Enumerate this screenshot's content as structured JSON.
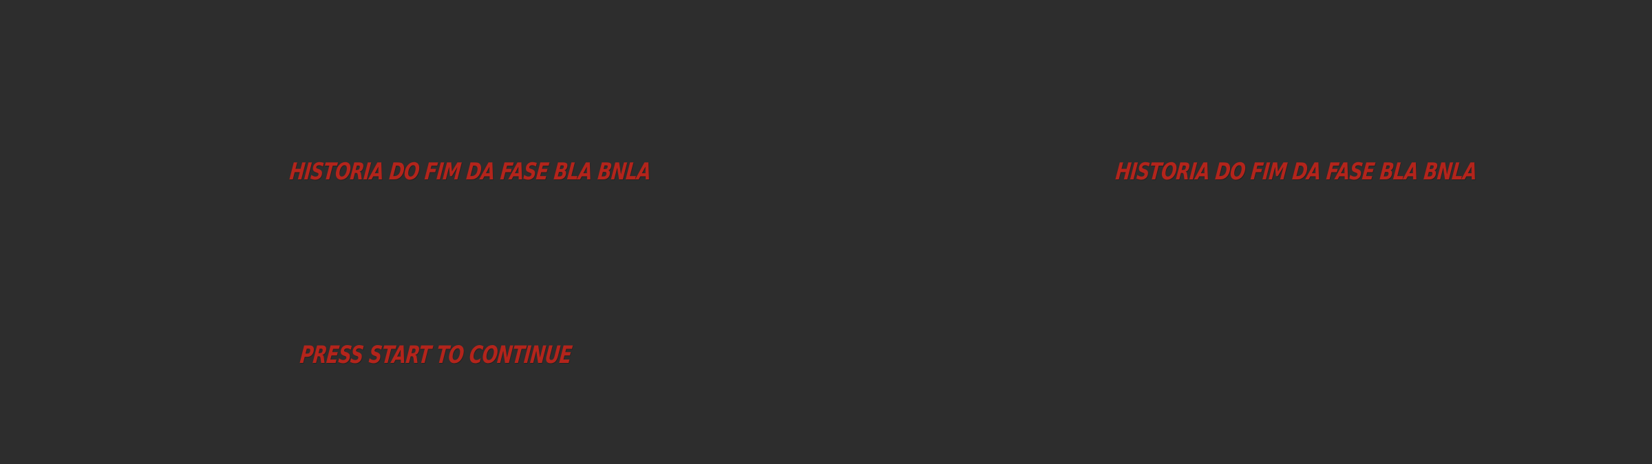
{
  "scene": {
    "background_color": "#2d2d2d",
    "text_color": "#b3241b"
  },
  "story": {
    "left_text": "HISTORIA DO FIM DA FASE BLA BNLA",
    "right_text": "HISTORIA DO FIM DA FASE BLA BNLA"
  },
  "prompt": {
    "label": "PRESS START TO CONTINUE"
  }
}
